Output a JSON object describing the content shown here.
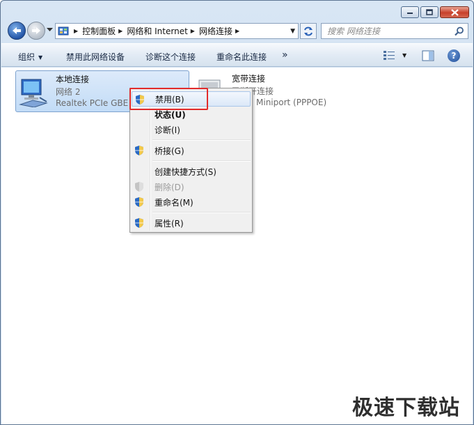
{
  "window": {
    "controls": [
      "minimize",
      "maximize",
      "close"
    ]
  },
  "address_bar": {
    "breadcrumbs": [
      "控制面板",
      "网络和 Internet",
      "网络连接"
    ]
  },
  "search": {
    "placeholder": "搜索 网络连接"
  },
  "command_bar": {
    "organize": "组织",
    "disable_device": "禁用此网络设备",
    "diagnose": "诊断这个连接",
    "rename": "重命名此连接",
    "more": "»",
    "help": "?"
  },
  "connections": [
    {
      "name": "本地连接",
      "status": "网络  2",
      "device": "Realtek PCIe GBE (",
      "selected": true
    },
    {
      "name": "宽带连接",
      "status": "已断开连接",
      "device": "Miniport (PPPOE)",
      "selected": false
    }
  ],
  "context_menu": {
    "items": [
      {
        "label": "禁用(B)",
        "shield": true,
        "highlighted": true
      },
      {
        "label": "状态(U)",
        "bold": true
      },
      {
        "label": "诊断(I)"
      },
      {
        "label": "桥接(G)",
        "shield": true
      },
      {
        "label": "创建快捷方式(S)"
      },
      {
        "label": "删除(D)",
        "shield": true,
        "disabled": true
      },
      {
        "label": "重命名(M)",
        "shield": true
      },
      {
        "label": "属性(R)",
        "shield": true
      }
    ]
  },
  "watermark": "极速下载站",
  "colors": {
    "highlight_box": "#e22b2b",
    "selection_bg": "#c2dcf7",
    "command_bar": "#dfe9f5"
  }
}
